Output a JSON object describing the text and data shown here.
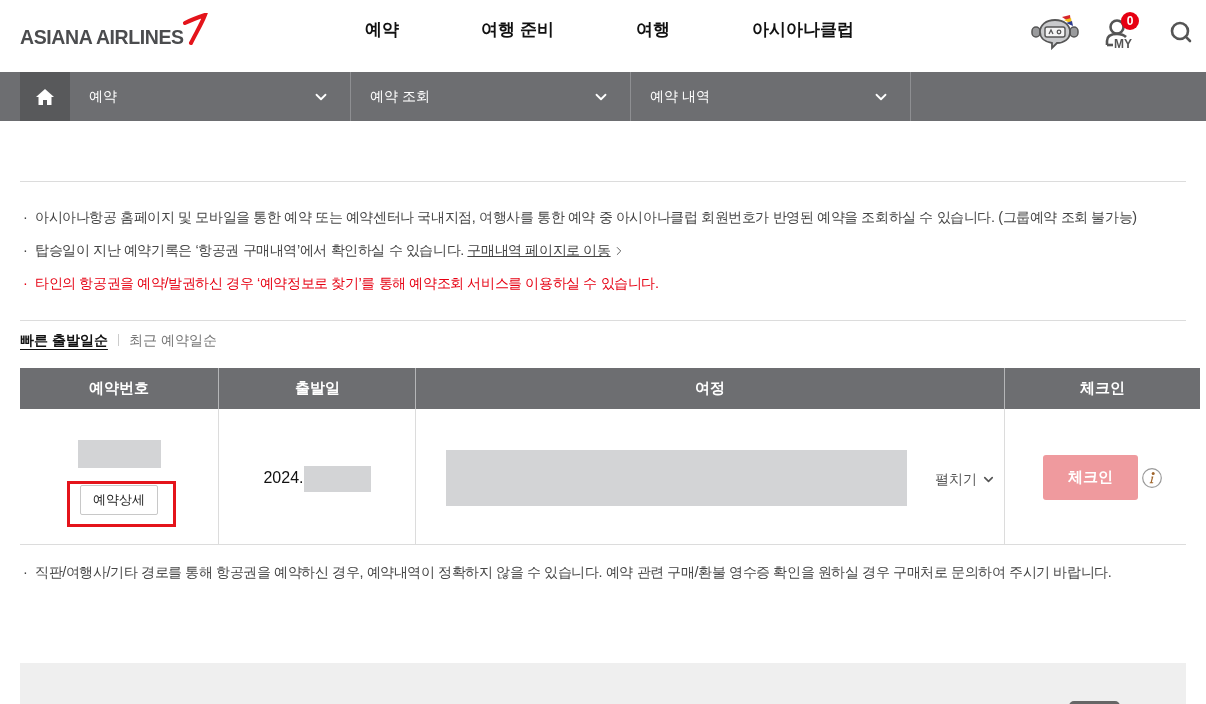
{
  "header": {
    "logo": "ASIANA AIRLINES",
    "nav": [
      {
        "label": "예약"
      },
      {
        "label": "여행 준비"
      },
      {
        "label": "여행"
      },
      {
        "label": "아시아나클럽"
      }
    ],
    "my": {
      "label": "MY",
      "badge": "0"
    }
  },
  "breadcrumb": [
    "예약",
    "예약 조회",
    "예약 내역"
  ],
  "notices": [
    {
      "kind": "info",
      "bullet": "·",
      "text": "아시아나항공 홈페이지 및 모바일을 통한 예약 또는 예약센터나 국내지점, 여행사를 통한 예약 중 아시아나클럽 회원번호가 반영된 예약을 조회하실 수 있습니다. (그룹예약 조회 불가능)"
    },
    {
      "kind": "info",
      "bullet": "·",
      "text": "탑승일이 지난 예약기록은 ‘항공권 구매내역’에서 확인하실 수 있습니다.",
      "link": "구매내역 페이지로 이동"
    },
    {
      "kind": "alert",
      "bullet": "·",
      "text": "타인의 항공권을 예약/발권하신 경우 ‘예약정보로 찾기’를 통해 예약조회 서비스를 이용하실 수 있습니다."
    }
  ],
  "sort_tabs": [
    {
      "label": "빠른 출발일순",
      "selected": true
    },
    {
      "label": "최근 예약일순",
      "selected": false
    }
  ],
  "table": {
    "columns": [
      "예약번호",
      "출발일",
      "여정",
      "체크인"
    ],
    "rows": [
      {
        "detail_button": {
          "label": "예약상세",
          "highlighted": true
        },
        "departure": "2024.",
        "expand_label": "펼치기",
        "checkin_button": {
          "label": "체크인",
          "disabled": true
        }
      }
    ]
  },
  "footnote": {
    "bullet": "·",
    "text": "직판/여행사/기타 경로를 통해 항공권을 예약하신 경우, 예약내역이 정확하지 않을 수 있습니다. 예약 관련 구매/환불 영수증 확인을 원하실 경우 구매처로 문의하여 주시기 바랍니다."
  }
}
